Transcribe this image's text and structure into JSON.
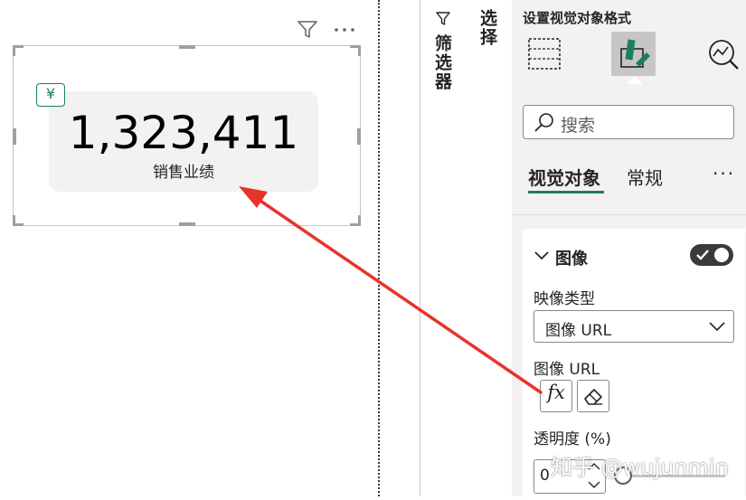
{
  "canvas": {
    "card": {
      "currency_icon": "yen-icon",
      "currency_symbol": "¥",
      "value": "1,323,411",
      "label": "销售业绩"
    },
    "header_icons": [
      "filter-icon",
      "more-options-icon"
    ]
  },
  "filters_pane": {
    "title": "筛选器",
    "icon": "filter-icon"
  },
  "visualizations_pane": {
    "strip_title": "选择",
    "title": "设置视觉对象格式",
    "tools": [
      {
        "name": "build-visual-icon"
      },
      {
        "name": "format-visual-icon",
        "selected": true
      },
      {
        "name": "analytics-icon"
      }
    ],
    "search": {
      "placeholder": "搜索"
    },
    "tabs": [
      {
        "label": "视觉对象",
        "active": true
      },
      {
        "label": "常规",
        "active": false
      }
    ],
    "more": "···",
    "section": {
      "title": "图像",
      "toggle_on": true,
      "image_type_label": "映像类型",
      "image_type_value": "图像 URL",
      "image_url_label": "图像 URL",
      "fx_label": "fx",
      "transparency_label": "透明度 (%)",
      "transparency_value": "0"
    }
  },
  "watermark": "知乎 @wujunmin",
  "colors": {
    "accent": "#1b7f5f",
    "annotation_arrow": "#e8332a",
    "pane_background": "#f3f2f1"
  }
}
